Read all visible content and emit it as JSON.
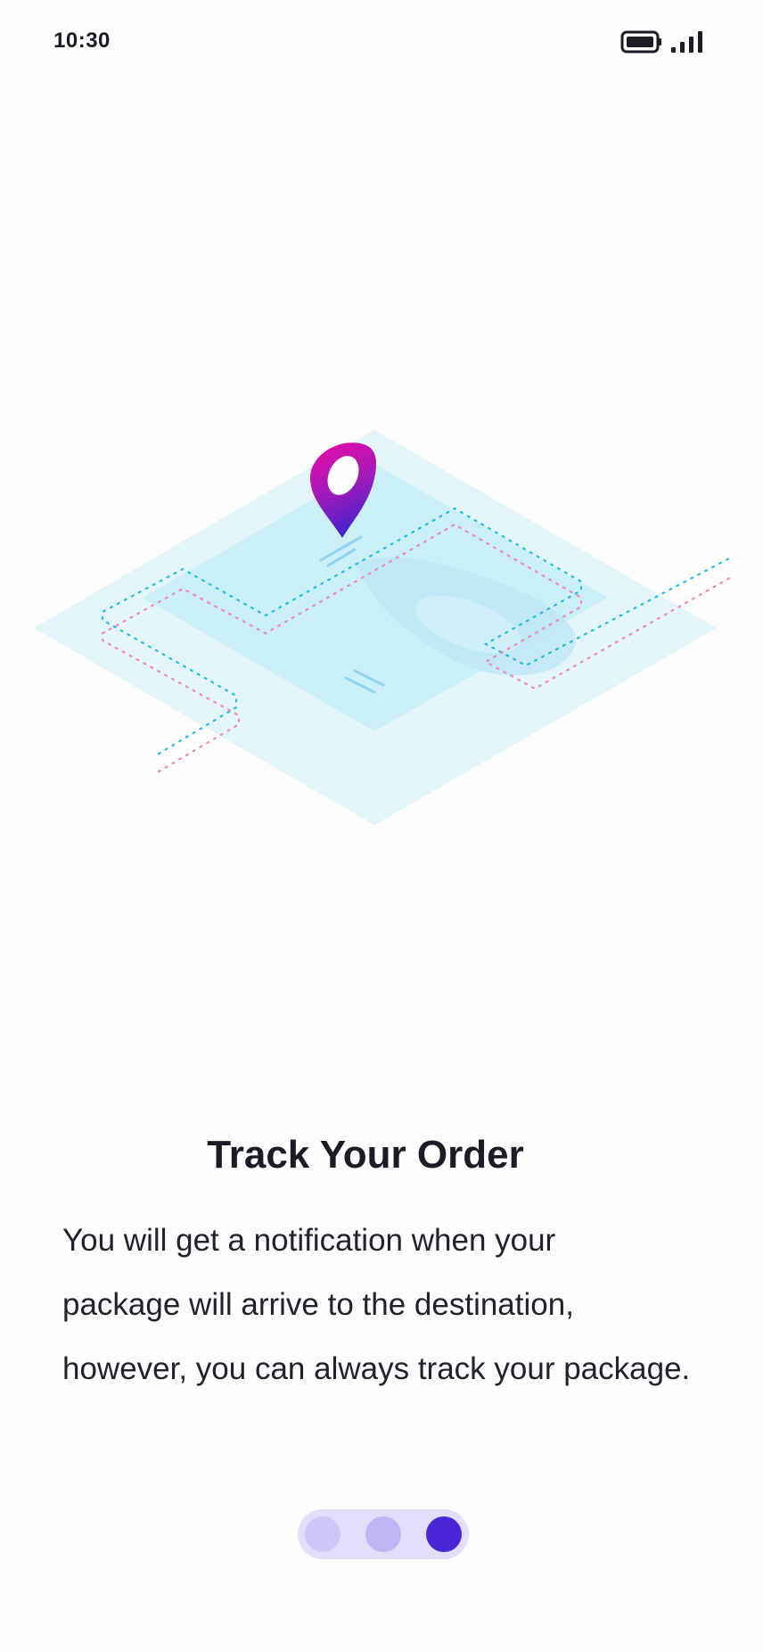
{
  "status_bar": {
    "time": "10:30",
    "battery_icon": "battery-full-icon",
    "signal_icon": "cellular-signal-icon"
  },
  "illustration": {
    "name": "isometric-map-with-location-pin",
    "pin_icon": "location-pin-icon",
    "colors": {
      "map_outer": "#e3f5f9",
      "map_inner": "#cbeff6",
      "route_primary": "#22c0de",
      "route_secondary": "#ef88b8",
      "pin_top": "#ec0aa8",
      "pin_bottom": "#4a22cc"
    }
  },
  "content": {
    "title": "Track Your Order",
    "description_lines": [
      "You will get a notification when your",
      "package will arrive to the destination,",
      "however, you can always track your package."
    ]
  },
  "pager": {
    "total_pages": 3,
    "current_page": 3,
    "colors": {
      "track": "#e2defb",
      "inactive_1": "#cfc8f7",
      "inactive_2": "#c0b6f4",
      "active": "#4a26d6"
    }
  }
}
